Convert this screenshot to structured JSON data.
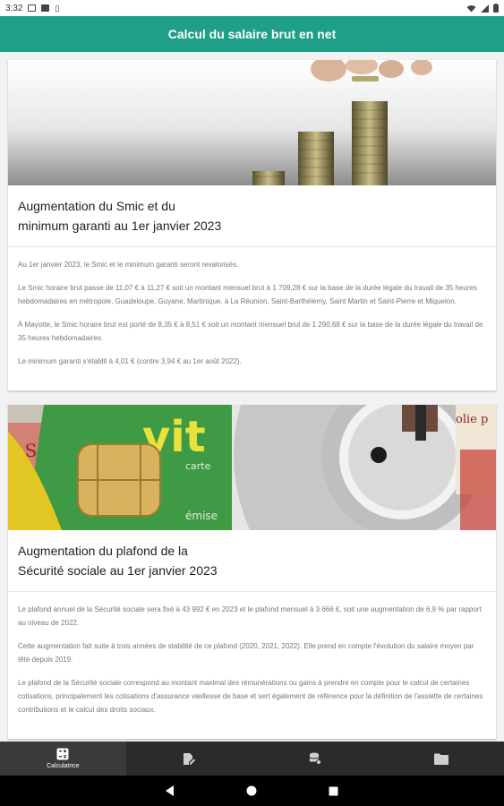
{
  "status": {
    "time": "3:32"
  },
  "appbar": {
    "title": "Calcul du salaire brut en net"
  },
  "cards": [
    {
      "image": "coins-stack-image",
      "title_line1": "Augmentation du Smic et du",
      "title_line2": "minimum garanti au 1er janvier 2023",
      "paragraphs": [
        "Au 1er janvier 2023, le Smic et le minimum garanti seront revalorisés.",
        "Le Smic horaire brut passe de 11,07 € à 11,27 € soit un montant mensuel brut à 1 709,28 € sur la base de la durée légale du travail de 35 heures hebdomadaires en métropole, Guadeloupe, Guyane, Martinique, à La Réunion, Saint-Barthélemy, Saint Martin et Saint-Pierre et Miquelon.",
        "À Mayotte, le Smic horaire brut est porté de 8,35 € à 8,51 € soit un montant mensuel brut de 1 290,68 € sur la base de la durée légale du travail de 35 heures hebdomadaires.",
        "Le minimum garanti s'établit à 4,01 € (contre 3,94 € au 1er août 2022)."
      ]
    },
    {
      "image": "vitale-card-stethoscope-image",
      "image_texts": {
        "vit": "vit",
        "carte": "carte",
        "emise": "émise",
        "ss": "s S",
        "police": "olie p"
      },
      "title_line1": "Augmentation du plafond de la",
      "title_line2": "Sécurité sociale au 1er janvier 2023",
      "paragraphs": [
        "Le plafond annuel de la Sécurité sociale sera fixé à 43 992 € en 2023 et le plafond mensuel à 3 666 €, soit une augmentation de 6,9 % par rapport au niveau de 2022.",
        "Cette augmentation fait suite à trois années de stabilité de ce plafond (2020, 2021, 2022). Elle prend en compte l'évolution du salaire moyen par tête depuis 2019.",
        "Le plafond de la Sécurité sociale correspond au montant maximal des rémunérations ou gains à prendre en compte pour le calcul de certaines cotisations, principalement les cotisations d'assurance vieillesse de base et sert également de référence pour la définition de l'assiette de certaines contributions et le calcul des droits sociaux."
      ]
    }
  ],
  "bottom_nav": [
    {
      "icon": "calculator-icon",
      "label": "Calculatrice",
      "active": true
    },
    {
      "icon": "edit-document-icon",
      "label": "",
      "active": false
    },
    {
      "icon": "database-settings-icon",
      "label": "",
      "active": false
    },
    {
      "icon": "folder-icon",
      "label": "",
      "active": false
    }
  ],
  "colors": {
    "accent": "#1f9f87",
    "nav_bg": "#2b2b2b"
  }
}
